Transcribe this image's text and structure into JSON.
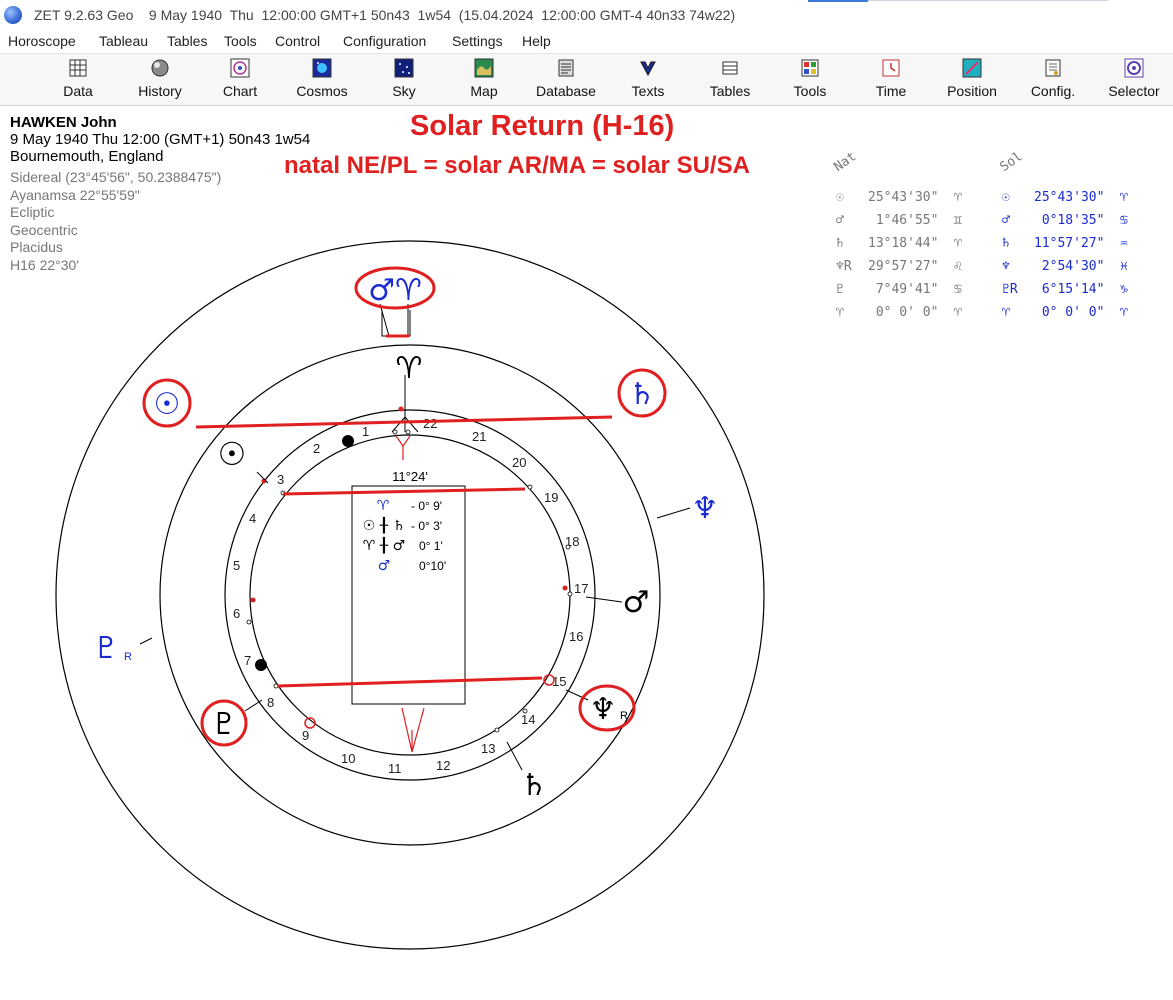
{
  "window": {
    "title": "ZET 9.2.63 Geo    9 May 1940  Thu  12:00:00 GMT+1 50n43  1w54  (15.04.2024  12:00:00 GMT-4 40n33 74w22)"
  },
  "menu": [
    "Horoscope",
    "Tableau",
    "Tables",
    "Tools",
    "Control",
    "Configuration",
    "Settings",
    "Help"
  ],
  "toolbar": [
    {
      "label": "Data",
      "icon": "data-icon"
    },
    {
      "label": "History",
      "icon": "history-icon"
    },
    {
      "label": "Chart",
      "icon": "chart-icon"
    },
    {
      "label": "Cosmos",
      "icon": "cosmos-icon"
    },
    {
      "label": "Sky",
      "icon": "sky-icon"
    },
    {
      "label": "Map",
      "icon": "map-icon"
    },
    {
      "label": "Database",
      "icon": "database-icon"
    },
    {
      "label": "Texts",
      "icon": "texts-icon"
    },
    {
      "label": "Tables",
      "icon": "tables-icon"
    },
    {
      "label": "Tools",
      "icon": "tools-icon"
    },
    {
      "label": "Time",
      "icon": "time-icon"
    },
    {
      "label": "Position",
      "icon": "position-icon"
    },
    {
      "label": "Config.",
      "icon": "config-icon"
    },
    {
      "label": "Selector",
      "icon": "selector-icon"
    }
  ],
  "person": {
    "name": "HAWKEN John",
    "date_line": "9 May 1940  Thu  12:00 (GMT+1) 50n43  1w54",
    "place": "Bournemouth, England",
    "settings": [
      "Sidereal (23°45'56\", 50.2388475\")",
      "Ayanamsa 22°55'59\"",
      "Ecliptic",
      "Geocentric",
      "Placidus",
      "H16  22°30'"
    ]
  },
  "annotation": {
    "title": "Solar Return (H-16)",
    "subtitle": "natal NE/PL = solar AR/MA = solar SU/SA"
  },
  "positions": {
    "col_natal": "Nat",
    "col_solar": "Sol",
    "rows": [
      {
        "nat_glyph": "☉",
        "nat_value": "25°43'30\"",
        "nat_sign": "♈",
        "sol_glyph": "☉",
        "sol_value": "25°43'30\"",
        "sol_sign": "♈"
      },
      {
        "nat_glyph": "♂",
        "nat_value": " 1°46'55\"",
        "nat_sign": "♊",
        "sol_glyph": "♂",
        "sol_value": " 0°18'35\"",
        "sol_sign": "♋"
      },
      {
        "nat_glyph": "♄",
        "nat_value": "13°18'44\"",
        "nat_sign": "♈",
        "sol_glyph": "♄",
        "sol_value": "11°57'27\"",
        "sol_sign": "♒"
      },
      {
        "nat_glyph": "♆R",
        "nat_value": "29°57'27\"",
        "nat_sign": "♌",
        "sol_glyph": "♆",
        "sol_value": " 2°54'30\"",
        "sol_sign": "♓"
      },
      {
        "nat_glyph": "♇",
        "nat_value": " 7°49'41\"",
        "nat_sign": "♋",
        "sol_glyph": "♇R",
        "sol_value": " 6°15'14\"",
        "sol_sign": "♑"
      },
      {
        "nat_glyph": "♈",
        "nat_value": " 0° 0' 0\"",
        "nat_sign": "♈",
        "sol_glyph": "♈",
        "sol_value": " 0° 0' 0\"",
        "sol_sign": "♈"
      }
    ]
  },
  "wheel": {
    "harmonic_numbers": [
      "1",
      "2",
      "3",
      "4",
      "5",
      "6",
      "7",
      "8",
      "9",
      "10",
      "11",
      "12",
      "13",
      "14",
      "15",
      "16",
      "17",
      "18",
      "19",
      "20",
      "21",
      "22"
    ],
    "mc_degree": "11°24'",
    "aspect_rows": [
      {
        "glyphs": "♈",
        "value": "- 0° 9'"
      },
      {
        "glyphs": "☉ ╂ ♄",
        "value": "- 0° 3'"
      },
      {
        "glyphs": "♈ ╂ ♂",
        "value": "0° 1'"
      },
      {
        "glyphs": "♂",
        "value": "0°10'"
      }
    ],
    "glyphs": {
      "mars_aries": "♂♈",
      "aries_black": "♈",
      "sun_blue": "☉",
      "saturn_blue": "♄",
      "neptune_blue": "♆",
      "sun_black": "☉",
      "mars_black": "♂",
      "pluto_blue": "♇",
      "pluto_r_label": "R",
      "pluto_black": "♇",
      "neptune_black": "♆",
      "neptune_r_label": "R",
      "saturn_black": "♄"
    },
    "colors": {
      "red": "#e02020",
      "blue": "#1a2bd0",
      "black": "#000000"
    }
  }
}
